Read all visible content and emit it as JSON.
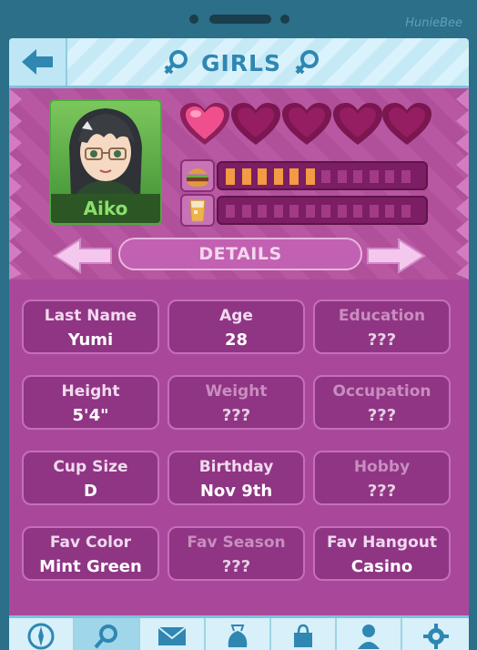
{
  "header": {
    "title": "GIRLS"
  },
  "brand": "HunieBee",
  "profile": {
    "name": "Aiko",
    "hearts": {
      "filled": 1,
      "total": 5
    },
    "hunger": {
      "level": 6,
      "max": 12
    },
    "thirst": {
      "level": 0,
      "max": 12
    }
  },
  "details": {
    "title": "DETAILS",
    "cards": [
      {
        "label": "Last Name",
        "value": "Yumi",
        "known": true
      },
      {
        "label": "Age",
        "value": "28",
        "known": true
      },
      {
        "label": "Education",
        "value": "???",
        "known": false
      },
      {
        "label": "Height",
        "value": "5'4\"",
        "known": true
      },
      {
        "label": "Weight",
        "value": "???",
        "known": false
      },
      {
        "label": "Occupation",
        "value": "???",
        "known": false
      },
      {
        "label": "Cup Size",
        "value": "D",
        "known": true
      },
      {
        "label": "Birthday",
        "value": "Nov 9th",
        "known": true
      },
      {
        "label": "Hobby",
        "value": "???",
        "known": false
      },
      {
        "label": "Fav Color",
        "value": "Mint Green",
        "known": true
      },
      {
        "label": "Fav Season",
        "value": "???",
        "known": false
      },
      {
        "label": "Fav Hangout",
        "value": "Casino",
        "known": true
      }
    ]
  },
  "footer": {
    "tabs": [
      "compass-icon",
      "search-icon",
      "mail-icon",
      "bag-icon",
      "shopping-icon",
      "person-icon",
      "gear-icon"
    ],
    "active": 1
  },
  "colors": {
    "accent": "#2f87b2",
    "panel": "#a9489a",
    "heart": "#f04f8e"
  }
}
